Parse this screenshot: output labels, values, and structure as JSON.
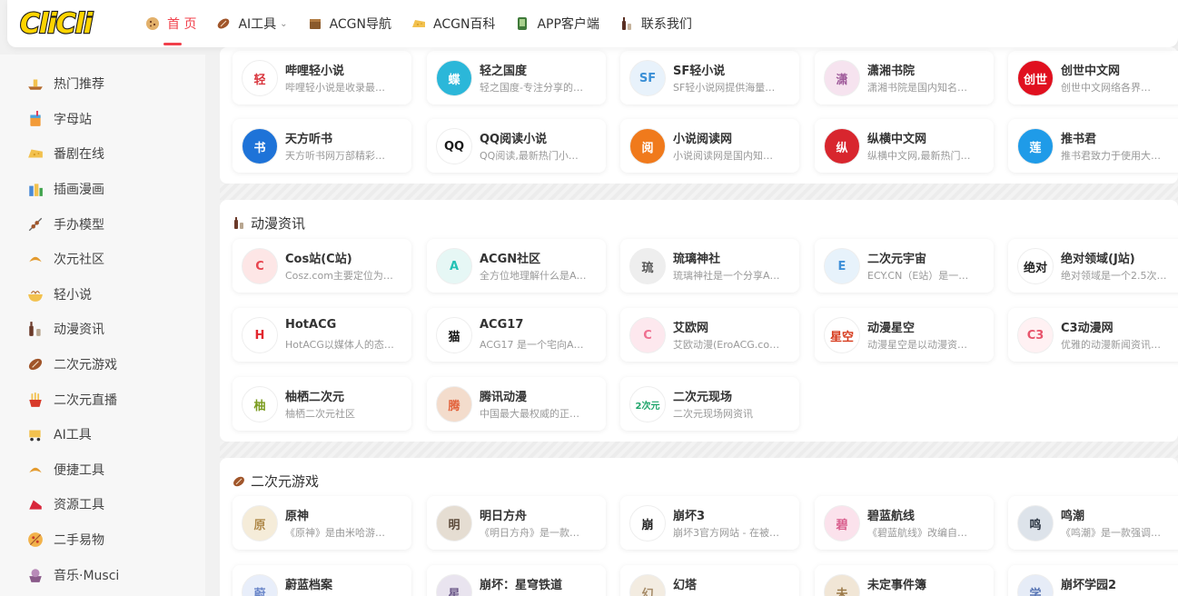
{
  "header": {
    "logo_text": "CliCli",
    "nav": [
      {
        "label": "首 页",
        "icon": "cookie-icon",
        "active": true,
        "dropdown": false
      },
      {
        "label": "AI工具",
        "icon": "rugby-icon",
        "active": false,
        "dropdown": true
      },
      {
        "label": "ACGN导航",
        "icon": "box-icon",
        "active": false,
        "dropdown": false
      },
      {
        "label": "ACGN百科",
        "icon": "cheese-icon",
        "active": false,
        "dropdown": false
      },
      {
        "label": "APP客户端",
        "icon": "phone-icon",
        "active": false,
        "dropdown": false
      },
      {
        "label": "联系我们",
        "icon": "bottle-icon",
        "active": false,
        "dropdown": false
      }
    ]
  },
  "sidebar": {
    "items": [
      {
        "label": "热门推荐",
        "icon": "boat-icon"
      },
      {
        "label": "字母站",
        "icon": "drink-icon"
      },
      {
        "label": "番剧在线",
        "icon": "cheese-icon"
      },
      {
        "label": "插画漫画",
        "icon": "bottles-icon"
      },
      {
        "label": "手办模型",
        "icon": "skewer-icon"
      },
      {
        "label": "次元社区",
        "icon": "croissant-icon"
      },
      {
        "label": "轻小说",
        "icon": "noodle-icon"
      },
      {
        "label": "动漫资讯",
        "icon": "wine-icon"
      },
      {
        "label": "二次元游戏",
        "icon": "rugby-icon"
      },
      {
        "label": "二次元直播",
        "icon": "fries-icon"
      },
      {
        "label": "AI工具",
        "icon": "cart-icon"
      },
      {
        "label": "便捷工具",
        "icon": "croissant-icon"
      },
      {
        "label": "资源工具",
        "icon": "heels-icon"
      },
      {
        "label": "二手易物",
        "icon": "pizza-icon"
      },
      {
        "label": "音乐·Musci",
        "icon": "cake-icon"
      }
    ]
  },
  "sections": [
    {
      "title": "",
      "cards": [
        {
          "name": "哔哩轻小说",
          "desc": "哔哩轻小说是收录最…",
          "color": "#ffffff",
          "fg": "#d9363e",
          "glyph": "轻"
        },
        {
          "name": "轻之国度",
          "desc": "轻之国度-专注分享的…",
          "color": "#2bb7d9",
          "fg": "#ffffff",
          "glyph": "蝶"
        },
        {
          "name": "SF轻小说",
          "desc": "SF轻小说网提供海量…",
          "color": "#e8f2fb",
          "fg": "#3a8fd6",
          "glyph": "SF"
        },
        {
          "name": "潇湘书院",
          "desc": "潇湘书院是国内知名…",
          "color": "#f6e3ef",
          "fg": "#a05c9b",
          "glyph": "潇"
        },
        {
          "name": "创世中文网",
          "desc": "创世中文网络各界…",
          "color": "#e0101f",
          "fg": "#ffffff",
          "glyph": "创世"
        },
        {
          "name": "天方听书",
          "desc": "天方听书网万部精彩…",
          "color": "#1e73d8",
          "fg": "#ffffff",
          "glyph": "书"
        },
        {
          "name": "QQ阅读小说",
          "desc": "QQ阅读,最新热门小…",
          "color": "#ffffff",
          "fg": "#1a1a1a",
          "glyph": "QQ"
        },
        {
          "name": "小说阅读网",
          "desc": "小说阅读网是国内知…",
          "color": "#f07a1c",
          "fg": "#ffffff",
          "glyph": "阅"
        },
        {
          "name": "纵横中文网",
          "desc": "纵横中文网,最新热门…",
          "color": "#d8262e",
          "fg": "#ffffff",
          "glyph": "纵"
        },
        {
          "name": "推书君",
          "desc": "推书君致力于使用大…",
          "color": "#1f9be8",
          "fg": "#ffffff",
          "glyph": "莲"
        }
      ]
    },
    {
      "title": "动漫资讯",
      "cards": [
        {
          "name": "Cos站(C站)",
          "desc": "Cosz.com主要定位为…",
          "color": "#fde6e6",
          "fg": "#e8454f",
          "glyph": "C"
        },
        {
          "name": "ACGN社区",
          "desc": "全方位地理解什么是A…",
          "color": "#e6f7f5",
          "fg": "#22c1b5",
          "glyph": "A"
        },
        {
          "name": "琉璃神社",
          "desc": "琉璃神社是一个分享A…",
          "color": "#eeeeee",
          "fg": "#555555",
          "glyph": "琉"
        },
        {
          "name": "二次元宇宙",
          "desc": "ECY.CN（E站）是一…",
          "color": "#e7f2fb",
          "fg": "#3f90d8",
          "glyph": "E"
        },
        {
          "name": "绝对领域(J站)",
          "desc": "绝对领域是一个2.5次…",
          "color": "#ffffff",
          "fg": "#222222",
          "glyph": "绝对"
        },
        {
          "name": "HotACG",
          "desc": "HotACG以媒体人的态…",
          "color": "#ffffff",
          "fg": "#e2262e",
          "glyph": "H"
        },
        {
          "name": "ACG17",
          "desc": "ACG17 是一个宅向A…",
          "color": "#ffffff",
          "fg": "#111111",
          "glyph": "猫"
        },
        {
          "name": "艾欧网",
          "desc": "艾欧动漫(EroACG.co…",
          "color": "#fde8ee",
          "fg": "#ef6f90",
          "glyph": "C"
        },
        {
          "name": "动漫星空",
          "desc": "动漫星空是以动漫资…",
          "color": "#ffffff",
          "fg": "#d63a1c",
          "glyph": "星空"
        },
        {
          "name": "C3动漫网",
          "desc": "优雅的动漫新闻资讯…",
          "color": "#fff1f3",
          "fg": "#e8546c",
          "glyph": "C3"
        },
        {
          "name": "柚栖二次元",
          "desc": "柚栖二次元社区",
          "color": "#ffffff",
          "fg": "#7a9b1e",
          "glyph": "柚"
        },
        {
          "name": "腾讯动漫",
          "desc": "中国最大最权威的正…",
          "color": "#f3dccc",
          "fg": "#e2613a",
          "glyph": "腾"
        },
        {
          "name": "二次元现场",
          "desc": "二次元现场网资讯",
          "color": "#ffffff",
          "fg": "#1fa56b",
          "glyph": "2次元"
        }
      ]
    },
    {
      "title": "二次元游戏",
      "cards": [
        {
          "name": "原神",
          "desc": "《原神》是由米哈游…",
          "color": "#f5ecd9",
          "fg": "#b08a4b",
          "glyph": "原"
        },
        {
          "name": "明日方舟",
          "desc": "《明日方舟》是一款…",
          "color": "#e5ddd2",
          "fg": "#5c4a3a",
          "glyph": "明"
        },
        {
          "name": "崩坏3",
          "desc": "崩坏3官方网站 - 在被…",
          "color": "#ffffff",
          "fg": "#222222",
          "glyph": "崩"
        },
        {
          "name": "碧蓝航线",
          "desc": "《碧蓝航线》改编自…",
          "color": "#fbe2ec",
          "fg": "#d95c8c",
          "glyph": "碧"
        },
        {
          "name": "鸣潮",
          "desc": "《鸣潮》是一款强调…",
          "color": "#dde3ea",
          "fg": "#2b3542",
          "glyph": "鸣"
        },
        {
          "name": "蔚蓝档案",
          "desc": "",
          "color": "#e8eefa",
          "fg": "#6a86c9",
          "glyph": "蔚"
        },
        {
          "name": "崩坏：星穹铁道",
          "desc": "",
          "color": "#e9e4ef",
          "fg": "#6d5a8a",
          "glyph": "星"
        },
        {
          "name": "幻塔",
          "desc": "",
          "color": "#f3ece1",
          "fg": "#a58a66",
          "glyph": "幻"
        },
        {
          "name": "未定事件簿",
          "desc": "",
          "color": "#f1e6d6",
          "fg": "#9c7a4a",
          "glyph": "未"
        },
        {
          "name": "崩坏学园2",
          "desc": "",
          "color": "#e6ecf7",
          "fg": "#5a77b5",
          "glyph": "学"
        }
      ]
    }
  ]
}
